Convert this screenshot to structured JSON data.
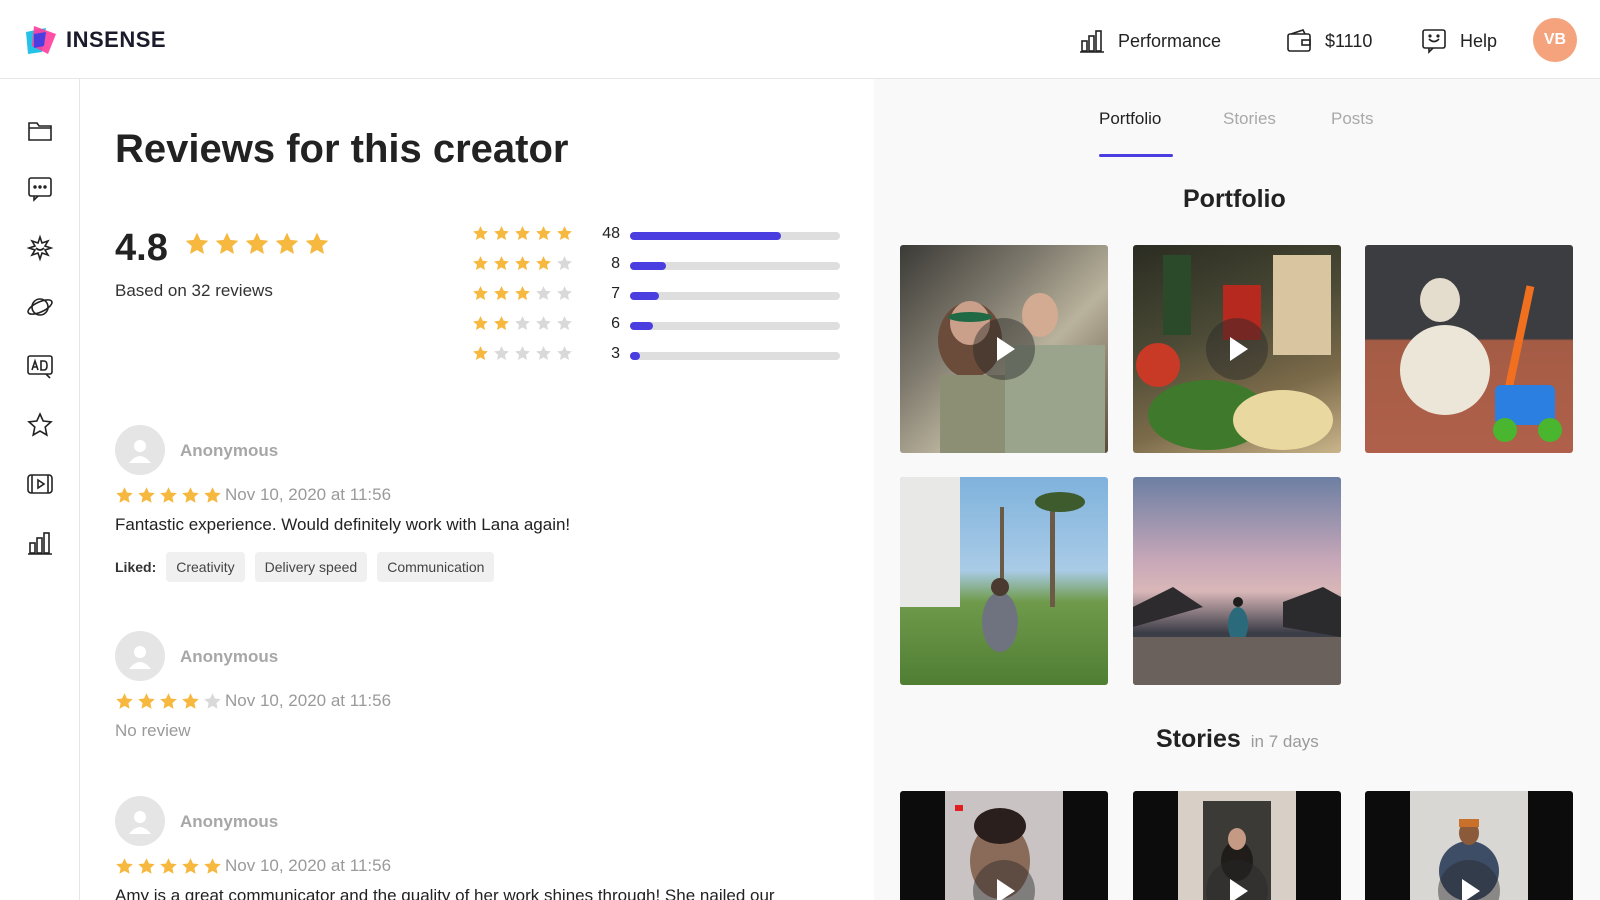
{
  "header": {
    "logo_text": "INSENSE",
    "nav": [
      {
        "label": "Performance",
        "icon": "bar-chart-icon"
      },
      {
        "label": "$1110",
        "icon": "wallet-icon"
      },
      {
        "label": "Help",
        "icon": "help-chat-icon"
      }
    ],
    "avatar_initials": "VB",
    "avatar_color": "#f4a37c"
  },
  "sidebar": {
    "icons": [
      "folder-icon",
      "chat-icon",
      "sparkle-badge-icon",
      "planet-icon",
      "ad-icon",
      "star-icon",
      "video-icon",
      "bar-chart-icon"
    ]
  },
  "reviews": {
    "title": "Reviews for this creator",
    "average": "4.8",
    "average_stars": 5,
    "caption": "Based on 32 reviews",
    "distribution": [
      {
        "stars": 5,
        "count": "48",
        "fraction": 0.72
      },
      {
        "stars": 4,
        "count": "8",
        "fraction": 0.17
      },
      {
        "stars": 3,
        "count": "7",
        "fraction": 0.14
      },
      {
        "stars": 2,
        "count": "6",
        "fraction": 0.11
      },
      {
        "stars": 1,
        "count": "3",
        "fraction": 0.04
      }
    ],
    "items": [
      {
        "name": "Anonymous",
        "stars": 5,
        "date": "Nov 10, 2020 at 11:56",
        "text": "Fantastic experience. Would definitely work with Lana again!",
        "liked_label": "Liked:",
        "liked": [
          "Creativity",
          "Delivery speed",
          "Communication"
        ]
      },
      {
        "name": "Anonymous",
        "stars": 4,
        "date": "Nov 10, 2020 at 11:56",
        "text": "No review"
      },
      {
        "name": "Anonymous",
        "stars": 5,
        "date": "Nov 10, 2020 at 11:56",
        "text": "Amy is a great communicator and the quality of her work shines through! She nailed our"
      }
    ]
  },
  "media": {
    "tabs": [
      "Portfolio",
      "Stories",
      "Posts"
    ],
    "active_tab": "Portfolio",
    "portfolio_title": "Portfolio",
    "stories_title": "Stories",
    "stories_sub": "in 7 days"
  },
  "colors": {
    "accent": "#4b3ee0",
    "star": "#f6b83f",
    "star_empty": "#d9d9d9"
  }
}
